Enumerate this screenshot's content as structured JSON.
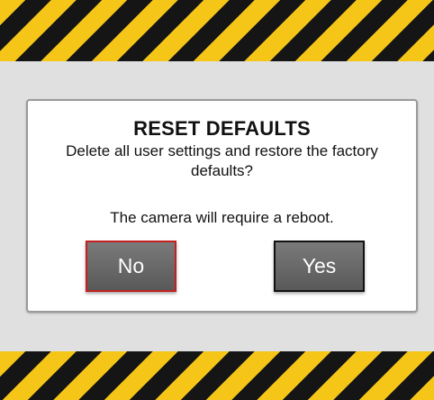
{
  "dialog": {
    "title": "RESET DEFAULTS",
    "message": "Delete all user settings and restore the factory defaults?",
    "note": "The camera will require a reboot."
  },
  "buttons": {
    "no_label": "No",
    "yes_label": "Yes"
  },
  "colors": {
    "hazard_yellow": "#f5c518",
    "hazard_black": "#151515",
    "background": "#e0e0e0",
    "focused_button_border": "#c42020"
  }
}
